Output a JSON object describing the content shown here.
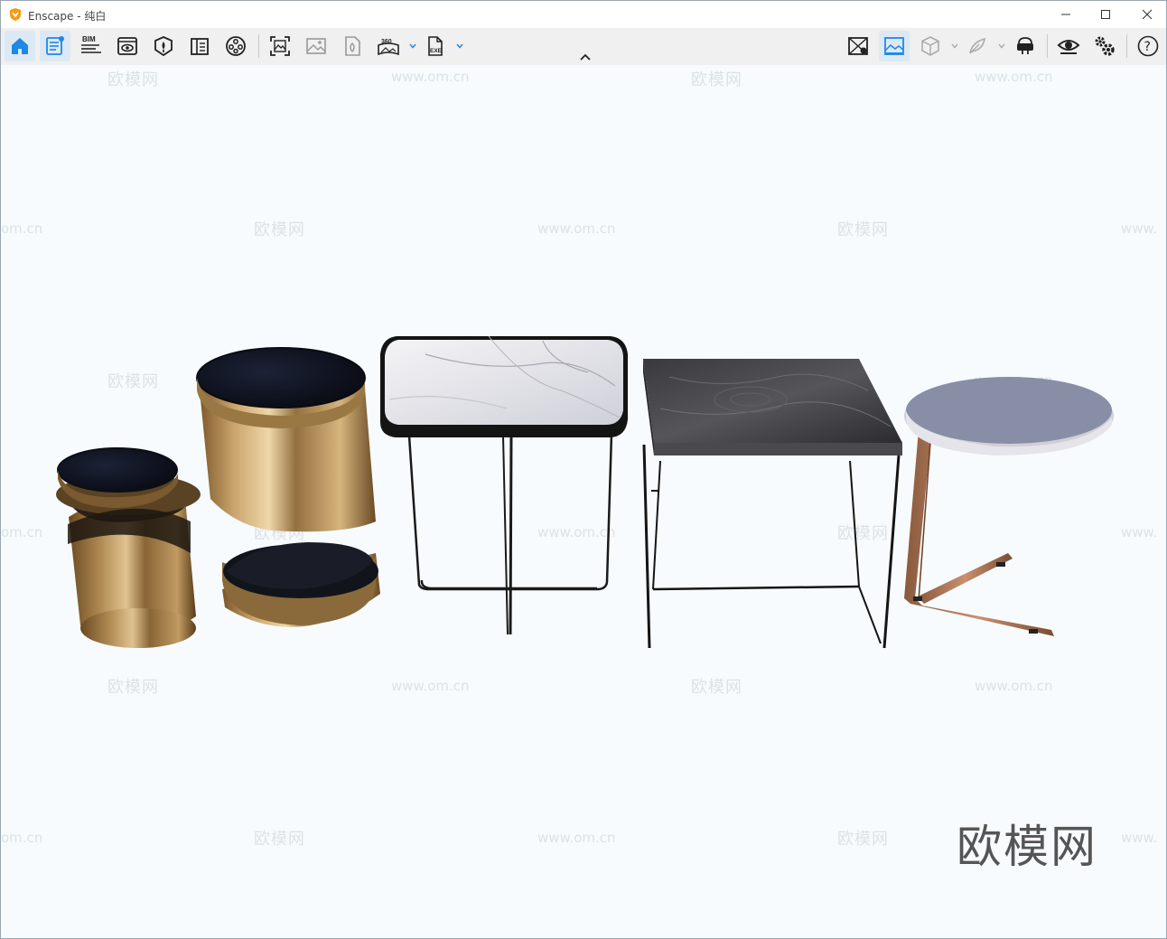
{
  "window": {
    "title": "Enscape - 纯白",
    "accent_color": "#1e88e5",
    "logo_color": "#f39c12"
  },
  "toolbar": {
    "left_buttons": [
      {
        "name": "home-icon",
        "active": true
      },
      {
        "name": "project-notes-icon",
        "active": true
      },
      {
        "name": "bim-icon",
        "label": "BIM"
      },
      {
        "name": "visual-settings-icon"
      },
      {
        "name": "asset-library-icon"
      },
      {
        "name": "material-editor-icon"
      },
      {
        "name": "video-editor-icon"
      },
      {
        "name": "render-screenshot-icon"
      },
      {
        "name": "batch-render-icon"
      },
      {
        "name": "export-web-icon"
      },
      {
        "name": "panorama-360-icon",
        "label": "360"
      },
      {
        "name": "export-exe-icon",
        "label": "EXE"
      }
    ],
    "right_buttons": [
      {
        "name": "views-icon"
      },
      {
        "name": "capture-image-icon"
      },
      {
        "name": "orthographic-view-icon"
      },
      {
        "name": "feather-icon"
      },
      {
        "name": "vr-headset-icon"
      },
      {
        "name": "eye-visibility-icon"
      },
      {
        "name": "settings-icon"
      },
      {
        "name": "help-icon",
        "label": "?"
      }
    ]
  },
  "viewport": {
    "background": "#f7fbfd",
    "watermark_text": "欧模网",
    "watermark_url": "www.om.cn",
    "watermark_url_fragment": "om.cn",
    "watermark_url_edge": "www.",
    "brand_mark": "欧模网",
    "objects": [
      {
        "name": "small-bronze-stool"
      },
      {
        "name": "tall-bronze-stool"
      },
      {
        "name": "marble-top-side-table"
      },
      {
        "name": "dark-wood-side-table"
      },
      {
        "name": "round-c-side-table"
      }
    ]
  }
}
